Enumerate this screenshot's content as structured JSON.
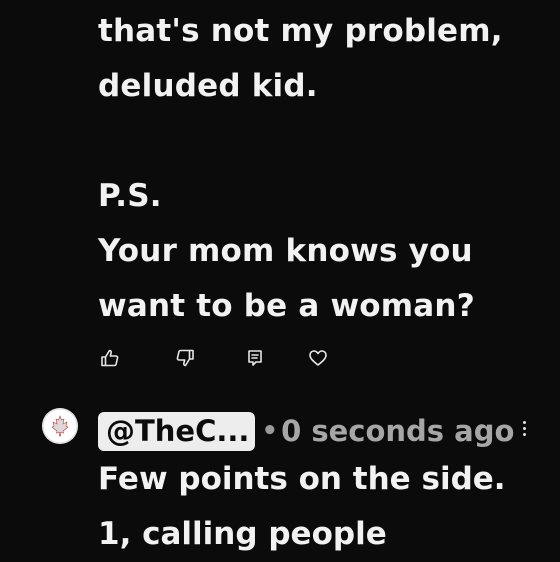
{
  "comment": {
    "lines": [
      "that's not my problem,",
      "deluded kid.",
      "",
      "P.S.",
      "Your mom knows you",
      "want to be a woman?"
    ],
    "actions": [
      {
        "name": "like",
        "icon": "thumbs-up-icon"
      },
      {
        "name": "dislike",
        "icon": "thumbs-down-icon"
      },
      {
        "name": "reply",
        "icon": "reply-icon"
      },
      {
        "name": "heart",
        "icon": "heart-icon"
      }
    ]
  },
  "reply": {
    "handle": "@TheC...",
    "separator": "•",
    "timestamp": "0 seconds ago",
    "text_lines": [
      "Few points on the side.",
      "1, calling people"
    ]
  },
  "colors": {
    "background": "#0b0b0b",
    "text": "#f2f2f2",
    "muted": "#a6a6a6",
    "handle_bg": "#ededed"
  }
}
